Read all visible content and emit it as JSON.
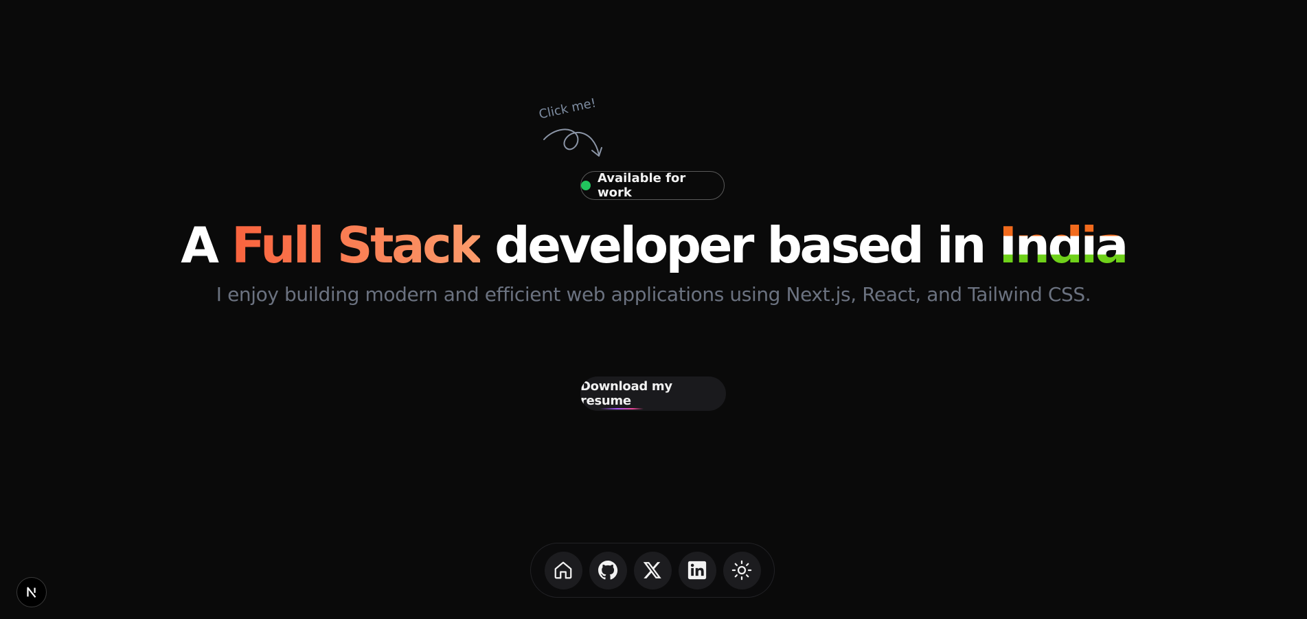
{
  "hint": {
    "text": "Click me!"
  },
  "status": {
    "label": "Available for work",
    "dot_color": "#22c55e"
  },
  "headline": {
    "prefix": "A ",
    "accent": "Full Stack",
    "middle": " developer based in ",
    "country": "India"
  },
  "subtitle": "I enjoy building modern and efficient web applications using Next.js, React, and Tailwind CSS.",
  "resume_button": {
    "label": "Download my resume"
  },
  "dock": {
    "items": [
      {
        "icon": "home-icon"
      },
      {
        "icon": "github-icon"
      },
      {
        "icon": "x-icon"
      },
      {
        "icon": "linkedin-icon"
      },
      {
        "icon": "sun-icon"
      }
    ]
  },
  "dev_badge": {
    "icon": "nextjs-icon"
  },
  "colors": {
    "background": "#0a0a0a",
    "accent_start": "#f9633e",
    "accent_end": "#fb9b6b",
    "saffron": "#f26b1d",
    "green": "#6fd11a",
    "muted_text": "#6b7280"
  }
}
